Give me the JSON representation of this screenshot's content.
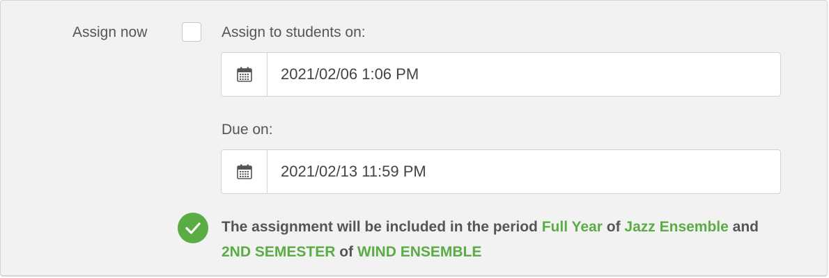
{
  "assign_now": {
    "label": "Assign now",
    "checked": false
  },
  "assign_date": {
    "label": "Assign to students on:",
    "value": "2021/02/06 1:06 PM",
    "icon": "calendar-icon"
  },
  "due_date": {
    "label": "Due on:",
    "value": "2021/02/13 11:59 PM",
    "icon": "calendar-icon"
  },
  "message": {
    "icon": "check-circle-icon",
    "prefix": "The assignment will be included in the period",
    "period_1": "Full Year",
    "of_1": "of",
    "class_1": "Jazz Ensemble",
    "and": "and",
    "period_2": "2ND SEMESTER",
    "of_2": "of",
    "class_2": "WIND ENSEMBLE"
  },
  "colors": {
    "accent_green": "#5aac44",
    "panel_bg": "#f2f2f2",
    "text": "#555555"
  }
}
